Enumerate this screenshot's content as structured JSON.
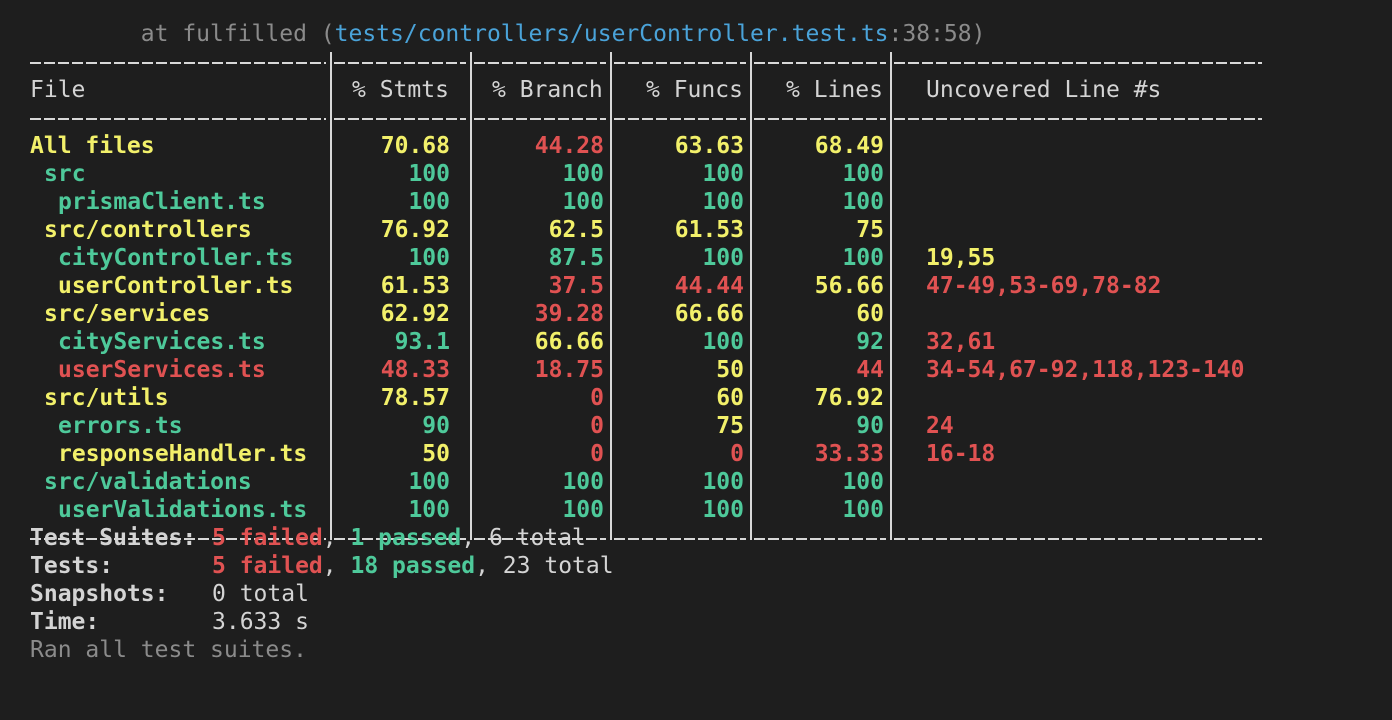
{
  "trace": {
    "prefix": "    at fulfilled (",
    "path": "tests/controllers/userController.test.ts",
    "suffix": ":38:58)"
  },
  "headers": [
    "File",
    "% Stmts",
    "% Branch",
    "% Funcs",
    "% Lines",
    "Uncovered Line #s"
  ],
  "rows": [
    {
      "file": "All files",
      "stmts": "70.68",
      "branch": "44.28",
      "funcs": "63.63",
      "lines": "68.49",
      "uncovered": "",
      "c": [
        "yellow",
        "yellow",
        "red",
        "yellow",
        "yellow",
        "white"
      ],
      "indent": 0
    },
    {
      "file": "src",
      "stmts": "100",
      "branch": "100",
      "funcs": "100",
      "lines": "100",
      "uncovered": "",
      "c": [
        "green",
        "green",
        "green",
        "green",
        "green",
        "white"
      ],
      "indent": 1
    },
    {
      "file": "prismaClient.ts",
      "stmts": "100",
      "branch": "100",
      "funcs": "100",
      "lines": "100",
      "uncovered": "",
      "c": [
        "green",
        "green",
        "green",
        "green",
        "green",
        "white"
      ],
      "indent": 2
    },
    {
      "file": "src/controllers",
      "stmts": "76.92",
      "branch": "62.5",
      "funcs": "61.53",
      "lines": "75",
      "uncovered": "",
      "c": [
        "yellow",
        "yellow",
        "yellow",
        "yellow",
        "yellow",
        "white"
      ],
      "indent": 1
    },
    {
      "file": "cityController.ts",
      "stmts": "100",
      "branch": "87.5",
      "funcs": "100",
      "lines": "100",
      "uncovered": "19,55",
      "c": [
        "green",
        "green",
        "green",
        "green",
        "green",
        "yellow"
      ],
      "indent": 2
    },
    {
      "file": "userController.ts",
      "stmts": "61.53",
      "branch": "37.5",
      "funcs": "44.44",
      "lines": "56.66",
      "uncovered": "47-49,53-69,78-82",
      "c": [
        "yellow",
        "yellow",
        "red",
        "red",
        "yellow",
        "red"
      ],
      "indent": 2
    },
    {
      "file": "src/services",
      "stmts": "62.92",
      "branch": "39.28",
      "funcs": "66.66",
      "lines": "60",
      "uncovered": "",
      "c": [
        "yellow",
        "yellow",
        "red",
        "yellow",
        "yellow",
        "white"
      ],
      "indent": 1
    },
    {
      "file": "cityServices.ts",
      "stmts": "93.1",
      "branch": "66.66",
      "funcs": "100",
      "lines": "92",
      "uncovered": "32,61",
      "c": [
        "green",
        "green",
        "yellow",
        "green",
        "green",
        "red"
      ],
      "indent": 2
    },
    {
      "file": "userServices.ts",
      "stmts": "48.33",
      "branch": "18.75",
      "funcs": "50",
      "lines": "44",
      "uncovered": "34-54,67-92,118,123-140",
      "c": [
        "red",
        "red",
        "red",
        "yellow",
        "red",
        "red"
      ],
      "indent": 2
    },
    {
      "file": "src/utils",
      "stmts": "78.57",
      "branch": "0",
      "funcs": "60",
      "lines": "76.92",
      "uncovered": "",
      "c": [
        "yellow",
        "yellow",
        "red",
        "yellow",
        "yellow",
        "white"
      ],
      "indent": 1
    },
    {
      "file": "errors.ts",
      "stmts": "90",
      "branch": "0",
      "funcs": "75",
      "lines": "90",
      "uncovered": "24",
      "c": [
        "green",
        "green",
        "red",
        "yellow",
        "green",
        "red"
      ],
      "indent": 2
    },
    {
      "file": "responseHandler.ts",
      "stmts": "50",
      "branch": "0",
      "funcs": "0",
      "lines": "33.33",
      "uncovered": "16-18",
      "c": [
        "yellow",
        "yellow",
        "red",
        "red",
        "red",
        "red"
      ],
      "indent": 2
    },
    {
      "file": "src/validations",
      "stmts": "100",
      "branch": "100",
      "funcs": "100",
      "lines": "100",
      "uncovered": "",
      "c": [
        "green",
        "green",
        "green",
        "green",
        "green",
        "white"
      ],
      "indent": 1
    },
    {
      "file": "userValidations.ts",
      "stmts": "100",
      "branch": "100",
      "funcs": "100",
      "lines": "100",
      "uncovered": "",
      "c": [
        "green",
        "green",
        "green",
        "green",
        "green",
        "white"
      ],
      "indent": 2
    }
  ],
  "summary": {
    "suites": {
      "label": "Test Suites:",
      "failed": "5 failed",
      "comma1": ", ",
      "passed": "1 passed",
      "total": ", 6 total"
    },
    "tests": {
      "label": "Tests:",
      "failed": "5 failed",
      "comma1": ", ",
      "passed": "18 passed",
      "total": ", 23 total"
    },
    "snapshots": {
      "label": "Snapshots:",
      "value": "0 total"
    },
    "time": {
      "label": "Time:",
      "value": "3.633 s"
    },
    "ran": "Ran all test suites."
  },
  "colors": {
    "background": "#1e1e1e",
    "yellow": "#f2f06a",
    "green": "#4ec99a",
    "red": "#e05252",
    "path": "#4aa3d9"
  }
}
